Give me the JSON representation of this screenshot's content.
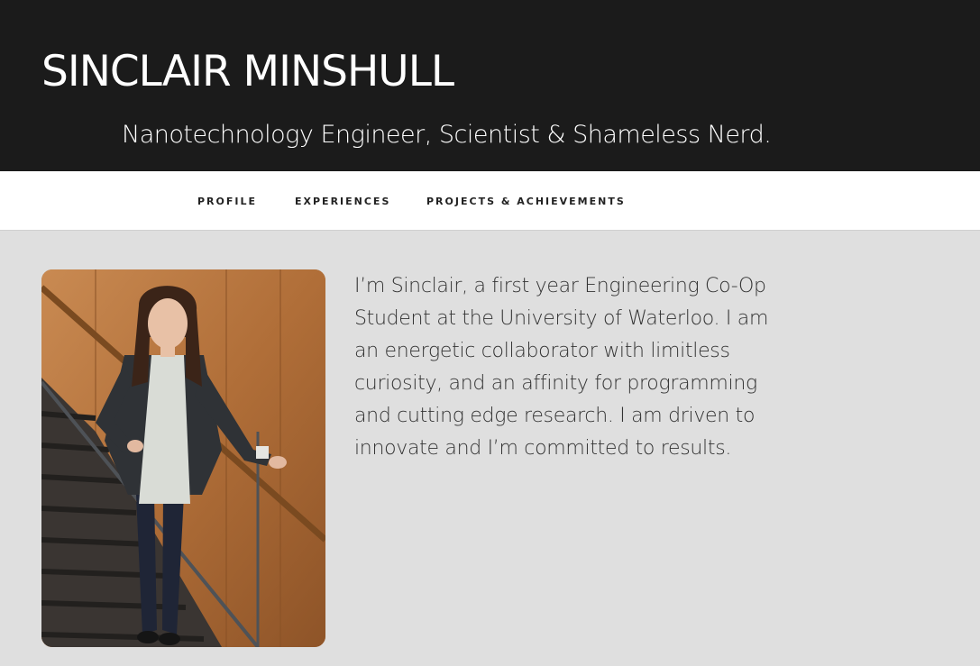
{
  "header": {
    "title": "SINCLAIR MINSHULL",
    "tagline": "Nanotechnology Engineer, Scientist & Shameless Nerd."
  },
  "nav": {
    "items": [
      {
        "label": "PROFILE"
      },
      {
        "label": "EXPERIENCES"
      },
      {
        "label": "PROJECTS & ACHIEVEMENTS"
      }
    ]
  },
  "main": {
    "bio": "I’m Sinclair, a first year Engineering Co-Op Student at the University of Waterloo. I am an energetic collaborator with limitless curiosity, and an affinity for programming and cutting edge research. I am driven to innovate and I’m committed to results."
  },
  "colors": {
    "header_bg": "#1b1b1b",
    "nav_bg": "#ffffff",
    "page_bg": "#dfdfdf",
    "text": "#333333"
  }
}
